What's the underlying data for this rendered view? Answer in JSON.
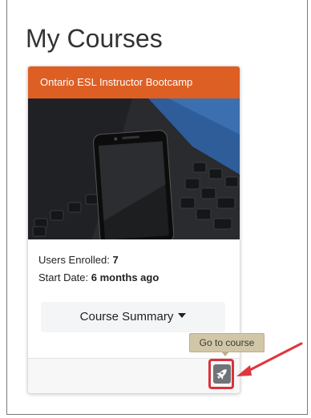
{
  "page": {
    "title": "My Courses"
  },
  "course_card": {
    "title": "Ontario ESL Instructor Bootcamp",
    "header_color": "#dd5f24",
    "image_description_icon": "smartphone-on-laptop-image",
    "users_enrolled_label": "Users Enrolled:",
    "users_enrolled_value": "7",
    "start_date_label": "Start Date:",
    "start_date_value": "6 months ago",
    "summary_button_label": "Course Summary",
    "go_button_icon": "rocket-icon"
  },
  "tooltip": {
    "text": "Go to course"
  },
  "annotation": {
    "highlight_color": "#d8333c"
  }
}
